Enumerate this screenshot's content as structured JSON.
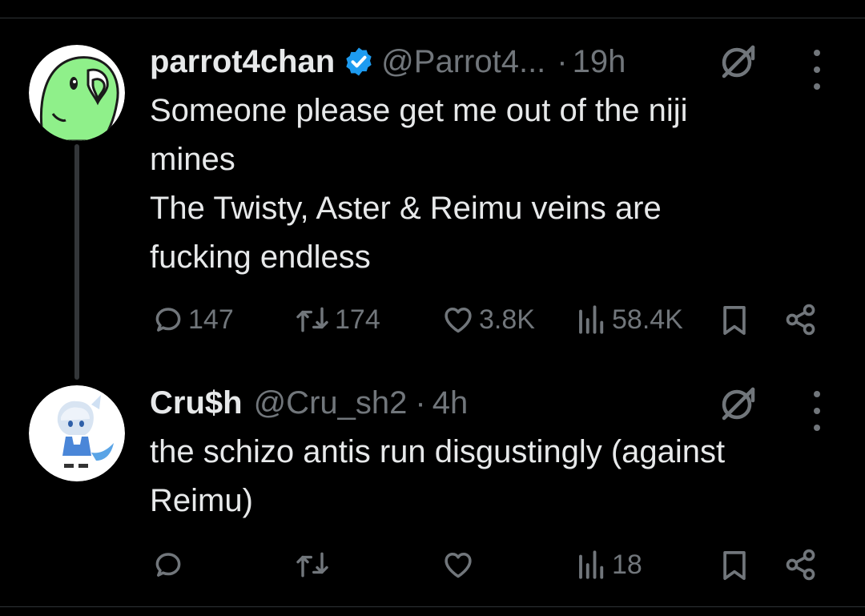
{
  "posts": [
    {
      "name": "parrot4chan",
      "handle": "@Parrot4...",
      "separator": "·",
      "time": "19h",
      "verified": true,
      "avatar_icon": "parrot-avatar",
      "lines": [
        "Someone please get me out of the niji",
        "mines",
        "The Twisty, Aster & Reimu veins are",
        "fucking endless"
      ],
      "replies": "147",
      "reposts": "174",
      "likes": "3.8K",
      "views": "58.4K"
    },
    {
      "name": "Cru$h",
      "handle": "@Cru_sh2",
      "separator": "·",
      "time": "4h",
      "verified": false,
      "avatar_icon": "anime-character-avatar",
      "lines": [
        "the schizo antis run disgustingly (against",
        "Reimu)"
      ],
      "replies": "",
      "reposts": "",
      "likes": "",
      "views": "18"
    }
  ],
  "colors": {
    "background": "#000000",
    "text": "#e7e9ea",
    "muted": "#71767b",
    "verified": "#1d9bf0",
    "divider": "#2f3336",
    "parrot_green": "#8ff08a"
  }
}
